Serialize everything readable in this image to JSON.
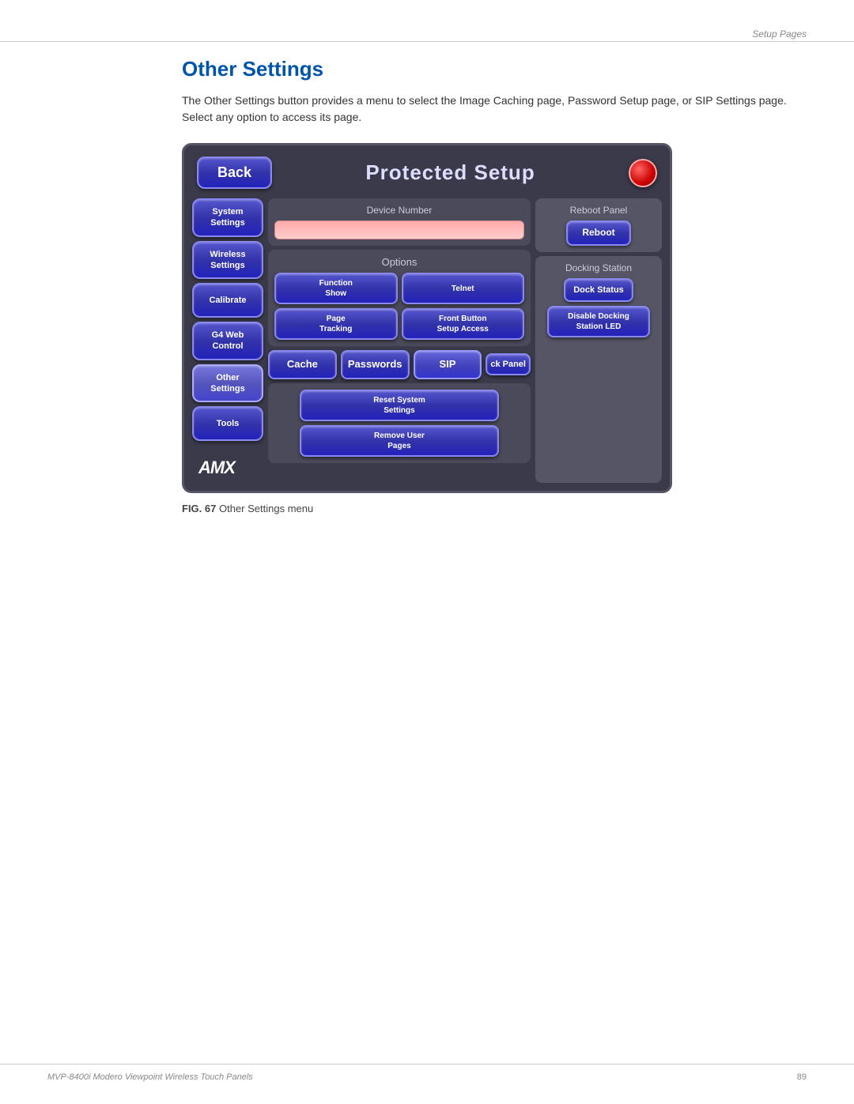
{
  "header": {
    "setup_pages_label": "Setup Pages"
  },
  "page": {
    "title": "Other Settings",
    "description": "The Other Settings button provides a menu to select the Image Caching page, Password Setup page, or SIP Settings page. Select any option to access its page."
  },
  "panel": {
    "back_label": "Back",
    "title": "Protected Setup",
    "nav": {
      "items": [
        {
          "label": "System\nSettings"
        },
        {
          "label": "Wireless\nSettings"
        },
        {
          "label": "Calibrate"
        },
        {
          "label": "G4 Web\nControl"
        },
        {
          "label": "Other\nSettings"
        },
        {
          "label": "Tools"
        }
      ]
    },
    "device_number_label": "Device Number",
    "reboot_panel_label": "Reboot Panel",
    "reboot_btn_label": "Reboot",
    "options_label": "Options",
    "function_show_label": "Function\nShow",
    "telnet_label": "Telnet",
    "page_tracking_label": "Page\nTracking",
    "front_button_label": "Front Button\nSetup Access",
    "cache_label": "Cache",
    "passwords_label": "Passwords",
    "sip_label": "SIP",
    "ck_panel_label": "ck Panel",
    "docking_station_label": "Docking Station",
    "dock_status_label": "Dock Status",
    "disable_docking_label": "Disable Docking\nStation LED",
    "reset_system_label": "Reset System\nSettings",
    "remove_user_label": "Remove User\nPages",
    "amx_logo": "AMX"
  },
  "caption": {
    "fig_number": "FIG. 67",
    "text": "Other Settings menu"
  },
  "footer": {
    "left": "MVP-8400i Modero Viewpoint Wireless Touch Panels",
    "right": "89"
  }
}
